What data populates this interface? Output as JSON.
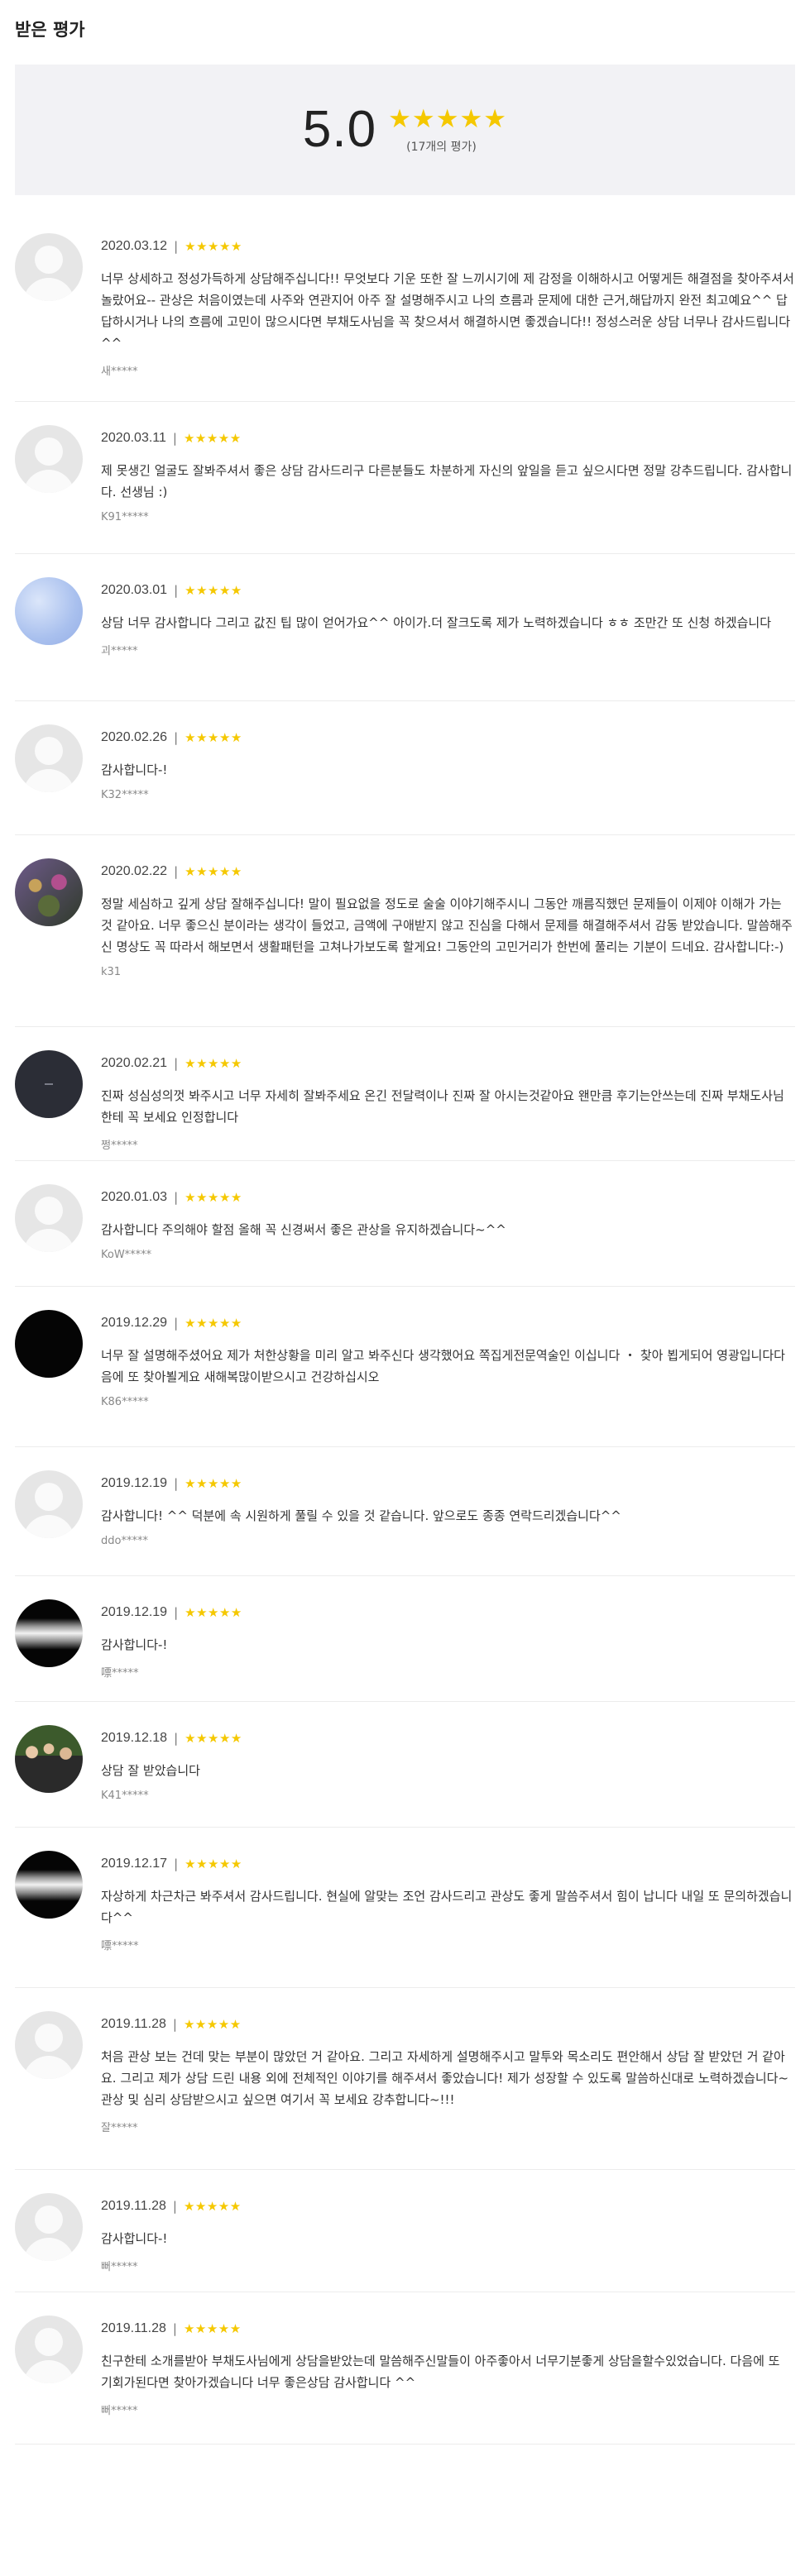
{
  "header": {
    "title": "받은 평가"
  },
  "summary": {
    "score": "5.0",
    "stars": "★★★★★",
    "count": "(17개의 평가)"
  },
  "colors": {
    "star": "#f5c800",
    "summary_bg": "#f2f2f5"
  },
  "reviews": [
    {
      "date": "2020.03.12",
      "stars": "★★★★★",
      "avatar": "default-avatar",
      "text": "너무 상세하고 정성가득하게 상담해주십니다!! 무엇보다 기운 또한 잘 느끼시기에 제 감정을 이해하시고 어떻게든 해결점을 찾아주셔서 놀랐어요-- 관상은 처음이였는데 사주와 연관지어 아주 잘 설명해주시고 나의 흐름과 문제에 대한 근거,해답까지 완전 최고예요^^ 답답하시거나 나의 흐름에 고민이 많으시다면 부채도사님을 꼭 찾으셔서 해결하시면 좋겠습니다!! 정성스러운 상담 너무나 감사드립니다^^",
      "author": "새*****"
    },
    {
      "date": "2020.03.11",
      "stars": "★★★★★",
      "avatar": "default-avatar",
      "text": "제 못생긴 얼굴도 잘봐주셔서 좋은 상담 감사드리구 다른분들도 차분하게 자신의 앞일을 듣고 싶으시다면 정말 강추드립니다. 감사합니다. 선생님 :)",
      "author": "K91*****"
    },
    {
      "date": "2020.03.01",
      "stars": "★★★★★",
      "avatar": "blue-gradient-avatar",
      "text": "상담 너무 감사합니다 그리고 값진 팁 많이 얻어가요^^ 아이가.더 잘크도록 제가 노력하겠습니다 ㅎㅎ 조만간 또 신청 하겠습니다",
      "author": "괴*****"
    },
    {
      "date": "2020.02.26",
      "stars": "★★★★★",
      "avatar": "default-avatar",
      "text": "감사합니다-!",
      "author": "K32*****"
    },
    {
      "date": "2020.02.22",
      "stars": "★★★★★",
      "avatar": "photo-avatar",
      "text": "정말 세심하고 깊게 상담 잘해주십니다! 말이 필요없을 정도로 술술 이야기해주시니 그동안 깨름직했던 문제들이 이제야 이해가 가는 것 같아요. 너무 좋으신 분이라는 생각이 들었고, 금액에 구애받지 않고 진심을 다해서 문제를 해결해주셔서 감동 받았습니다. 말씀해주신 명상도 꼭 따라서 해보면서 생활패턴을 고쳐나가보도록 할게요! 그동안의 고민거리가 한번에 풀리는 기분이 드네요. 감사합니다:-)",
      "author": "k31"
    },
    {
      "date": "2020.02.21",
      "stars": "★★★★★",
      "avatar": "navy-avatar",
      "text": "진짜 성심성의껏 봐주시고 너무 자세히 잘봐주세요 온긴 전달력이나 진짜 잘 아시는것같아요 왠만큼 후기는안쓰는데 진짜 부채도사님한테 꼭 보세요 인정합니다",
      "author": "쩡*****"
    },
    {
      "date": "2020.01.03",
      "stars": "★★★★★",
      "avatar": "default-avatar",
      "text": "감사합니다 주의해야 할점 올해 꼭 신경써서 좋은 관상을 유지하겠습니다~^^",
      "author": "KoW*****"
    },
    {
      "date": "2019.12.29",
      "stars": "★★★★★",
      "avatar": "black-avatar",
      "text": "너무 잘 설명해주셨어요 제가 처한상황을 미리 알고 봐주신다 생각했어요 쪽집게전문역술인 이십니다 ・ 찾아 뵙게되어 영광입니다다음에 또 찾아뵐게요 새해복많이받으시고 건강하십시오",
      "author": "K86*****"
    },
    {
      "date": "2019.12.19",
      "stars": "★★★★★",
      "avatar": "default-avatar",
      "text": "감사합니다! ^^ 덕분에 속 시원하게 풀릴 수 있을 것 같습니다. 앞으로도 종종 연락드리겠습니다^^",
      "author": "ddo*****"
    },
    {
      "date": "2019.12.19",
      "stars": "★★★★★",
      "avatar": "striped-avatar",
      "text": "감사합니다-!",
      "author": "嘌*****"
    },
    {
      "date": "2019.12.18",
      "stars": "★★★★★",
      "avatar": "group-photo-avatar",
      "text": "상담 잘 받았습니다",
      "author": "K41*****"
    },
    {
      "date": "2019.12.17",
      "stars": "★★★★★",
      "avatar": "striped-avatar",
      "text": "자상하게 차근차근 봐주셔서 감사드립니다. 현실에 알맞는 조언 감사드리고 관상도 좋게 말씀주셔서 힘이 납니다 내일 또 문의하겠습니다^^",
      "author": "嘌*****"
    },
    {
      "date": "2019.11.28",
      "stars": "★★★★★",
      "avatar": "default-avatar",
      "text": "처음 관상 보는 건데 맞는 부분이 많았던 거 같아요. 그리고 자세하게 설명해주시고 말투와 목소리도 편안해서 상담 잘 받았던 거 같아요. 그리고 제가 상담 드린 내용 외에 전체적인 이야기를 해주셔서 좋았습니다! 제가 성장할 수 있도록 말씀하신대로 노력하겠습니다~ 관상 및 심리 상담받으시고 싶으면 여기서 꼭 보세요 강추합니다~!!!",
      "author": "잘*****"
    },
    {
      "date": "2019.11.28",
      "stars": "★★★★★",
      "avatar": "default-avatar",
      "text": "감사합니다-!",
      "author": "뻐*****"
    },
    {
      "date": "2019.11.28",
      "stars": "★★★★★",
      "avatar": "default-avatar",
      "text": "친구한테 소개를받아 부채도사님에게 상담을받았는데 말씀해주신말들이 아주좋아서 너무기분좋게 상담을할수있었습니다. 다음에 또 기회가된다면 찾아가겠습니다 너무 좋은상담 감사합니다 ^^",
      "author": "뻐*****"
    }
  ]
}
